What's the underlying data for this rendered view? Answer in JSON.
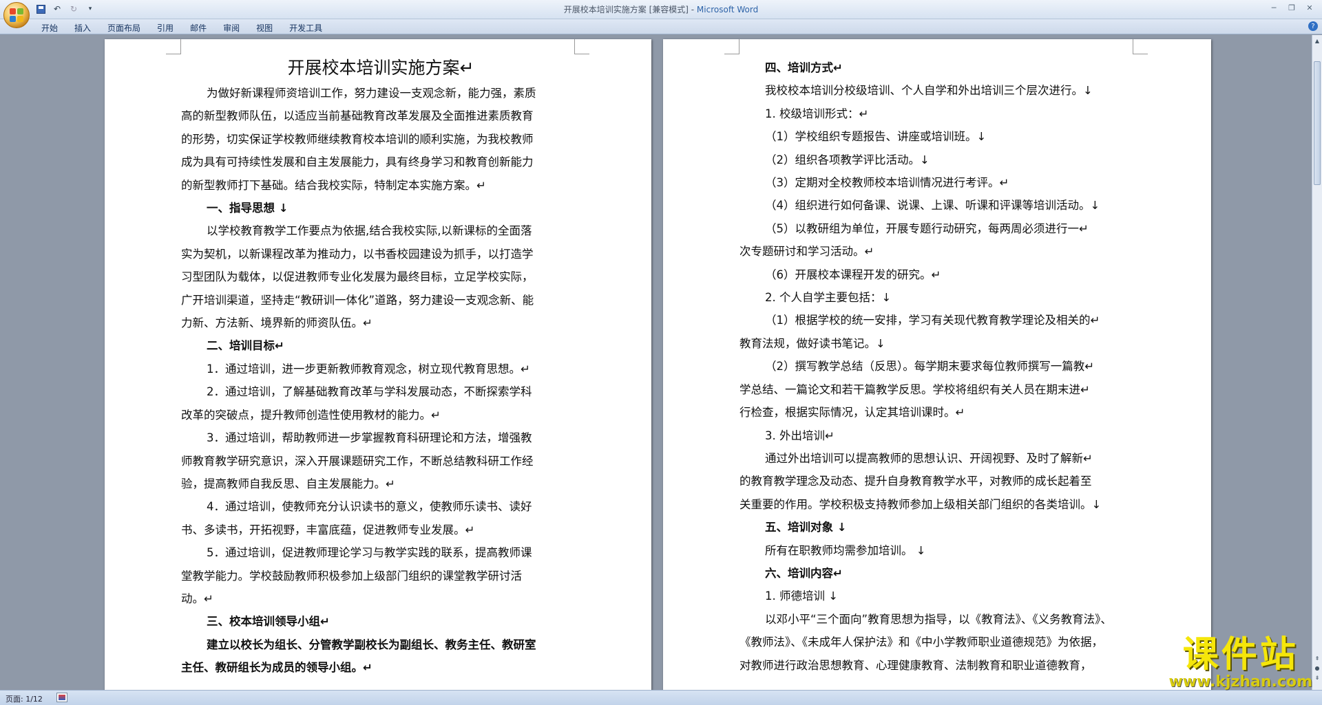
{
  "window": {
    "title": "开展校本培训实施方案 [兼容模式] - ",
    "app_name": "Microsoft Word"
  },
  "ribbon": {
    "tabs": [
      "开始",
      "插入",
      "页面布局",
      "引用",
      "邮件",
      "审阅",
      "视图",
      "开发工具"
    ]
  },
  "document": {
    "left_page": [
      {
        "text": "开展校本培训实施方案↵",
        "style": "title"
      },
      {
        "text": "为做好新课程师资培训工作，努力建设一支观念新，能力强，素质",
        "style": "ind"
      },
      {
        "text": "高的新型教师队伍，以适应当前基础教育改革发展及全面推进素质教育",
        "style": ""
      },
      {
        "text": "的形势，切实保证学校教师继续教育校本培训的顺利实施，为我校教师",
        "style": ""
      },
      {
        "text": "成为具有可持续性发展和自主发展能力，具有终身学习和教育创新能力",
        "style": ""
      },
      {
        "text": "的新型教师打下基础。结合我校实际，特制定本实施方案。↵",
        "style": ""
      },
      {
        "text": "一、指导思想 ↓",
        "style": "ind b"
      },
      {
        "text": "以学校教育教学工作要点为依据,结合我校实际,以新课标的全面落",
        "style": "ind"
      },
      {
        "text": "实为契机，以新课程改革为推动力，以书香校园建设为抓手，以打造学",
        "style": ""
      },
      {
        "text": "习型团队为载体，以促进教师专业化发展为最终目标，立足学校实际，",
        "style": ""
      },
      {
        "text": "广开培训渠道，坚持走“教研训一体化”道路，努力建设一支观念新、能",
        "style": ""
      },
      {
        "text": "力新、方法新、境界新的师资队伍。↵",
        "style": ""
      },
      {
        "text": "二、培训目标↵",
        "style": "ind b"
      },
      {
        "text": "1．通过培训，进一步更新教师教育观念，树立现代教育思想。↵",
        "style": "ind"
      },
      {
        "text": "2．通过培训，了解基础教育改革与学科发展动态，不断探索学科",
        "style": "ind"
      },
      {
        "text": "改革的突破点，提升教师创造性使用教材的能力。↵",
        "style": ""
      },
      {
        "text": "3．通过培训，帮助教师进一步掌握教育科研理论和方法，增强教",
        "style": "ind"
      },
      {
        "text": "师教育教学研究意识，深入开展课题研究工作，不断总结教科研工作经",
        "style": ""
      },
      {
        "text": "验，提高教师自我反思、自主发展能力。↵",
        "style": ""
      },
      {
        "text": "4．通过培训，使教师充分认识读书的意义，使教师乐读书、读好",
        "style": "ind"
      },
      {
        "text": "书、多读书，开拓视野，丰富底蕴，促进教师专业发展。↵",
        "style": ""
      },
      {
        "text": "5．通过培训，促进教师理论学习与教学实践的联系，提高教师课",
        "style": "ind"
      },
      {
        "text": "堂教学能力。学校鼓励教师积极参加上级部门组织的课堂教学研讨活",
        "style": ""
      },
      {
        "text": "动。↵",
        "style": ""
      },
      {
        "text": "三、校本培训领导小组↵",
        "style": "ind b"
      },
      {
        "text": "建立以校长为组长、分管教学副校长为副组长、教务主任、教研室",
        "style": "ind b"
      },
      {
        "text": "主任、教研组长为成员的领导小组。↵",
        "style": "b"
      }
    ],
    "right_page": [
      {
        "text": "四、培训方式↵",
        "style": "ind b"
      },
      {
        "text": "我校校本培训分校级培训、个人自学和外出培训三个层次进行。↓",
        "style": "ind"
      },
      {
        "text": "1. 校级培训形式：↵",
        "style": "ind"
      },
      {
        "text": "（1）学校组织专题报告、讲座或培训班。↓",
        "style": "ind"
      },
      {
        "text": "（2）组织各项教学评比活动。↓",
        "style": "ind"
      },
      {
        "text": "（3）定期对全校教师校本培训情况进行考评。↵",
        "style": "ind"
      },
      {
        "text": "（4）组织进行如何备课、说课、上课、听课和评课等培训活动。↓",
        "style": "ind"
      },
      {
        "text": "（5）以教研组为单位，开展专题行动研究，每两周必须进行一↵",
        "style": "ind"
      },
      {
        "text": "次专题研讨和学习活动。↵",
        "style": ""
      },
      {
        "text": "（6）开展校本课程开发的研究。↵",
        "style": "ind"
      },
      {
        "text": "2. 个人自学主要包括：↓",
        "style": "ind"
      },
      {
        "text": "（1）根据学校的统一安排，学习有关现代教育教学理论及相关的↵",
        "style": "ind"
      },
      {
        "text": "教育法规，做好读书笔记。↓",
        "style": ""
      },
      {
        "text": "（2）撰写教学总结（反思）。每学期末要求每位教师撰写一篇教↵",
        "style": "ind"
      },
      {
        "text": "学总结、一篇论文和若干篇教学反思。学校将组织有关人员在期末进↵",
        "style": ""
      },
      {
        "text": "行检查，根据实际情况，认定其培训课时。↵",
        "style": ""
      },
      {
        "text": "3. 外出培训↵",
        "style": "ind"
      },
      {
        "text": "通过外出培训可以提高教师的思想认识、开阔视野、及时了解新↵",
        "style": "ind"
      },
      {
        "text": "的教育教学理念及动态、提升自身教育教学水平，对教师的成长起着至",
        "style": ""
      },
      {
        "text": "关重要的作用。学校积极支持教师参加上级相关部门组织的各类培训。↓",
        "style": ""
      },
      {
        "text": "五、培训对象 ↓",
        "style": "ind b"
      },
      {
        "text": "所有在职教师均需参加培训。 ↓",
        "style": "ind"
      },
      {
        "text": "六、培训内容↵",
        "style": "ind b"
      },
      {
        "text": "1. 师德培训 ↓",
        "style": "ind"
      },
      {
        "text": "以邓小平“三个面向”教育思想为指导，以《教育法》、《义务教育法》、",
        "style": "ind"
      },
      {
        "text": "《教师法》、《未成年人保护法》和《中小学教师职业道德规范》为依据，",
        "style": ""
      },
      {
        "text": "对教师进行政治思想教育、心理健康教育、法制教育和职业道德教育，",
        "style": ""
      }
    ]
  },
  "statusbar": {
    "page_info": "页面: 1/12"
  },
  "watermark": {
    "cn": "课件站",
    "url": "www.kjzhan.com"
  },
  "colors": {
    "app_name": "#2e63a8",
    "watermark": "#f5e60a",
    "workspace": "#8f99a8"
  }
}
